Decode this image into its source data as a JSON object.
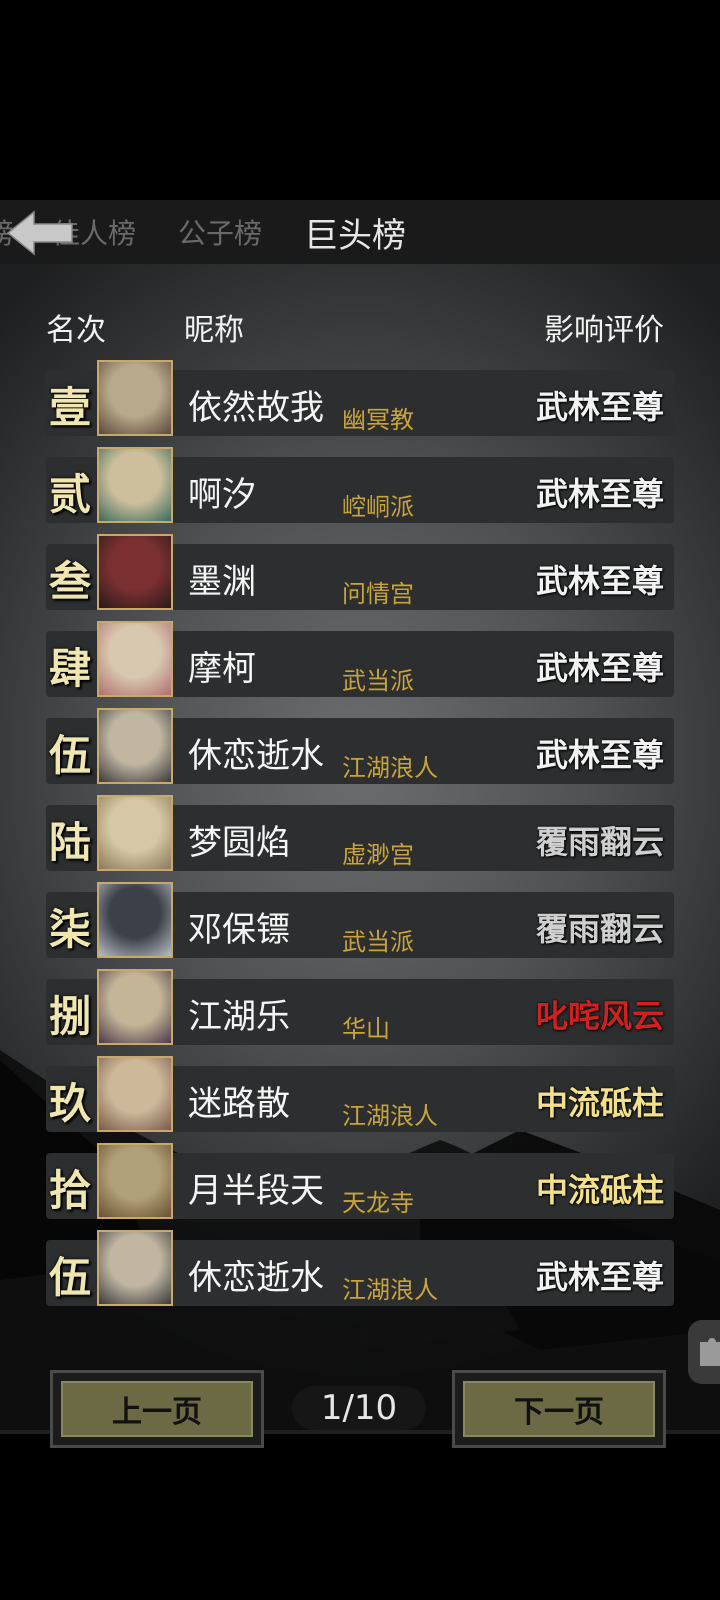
{
  "tabs": [
    {
      "label": "榜"
    },
    {
      "label": "佳人榜"
    },
    {
      "label": "公子榜"
    },
    {
      "label": "巨头榜"
    }
  ],
  "headers": {
    "rank": "名次",
    "nickname": "昵称",
    "rating": "影响评价"
  },
  "rows": [
    {
      "rank": "壹",
      "name": "依然故我",
      "sect": "幽冥教",
      "title": "武林至尊",
      "title_color": "#f2f2f2"
    },
    {
      "rank": "贰",
      "name": "啊汐",
      "sect": "崆峒派",
      "title": "武林至尊",
      "title_color": "#f2f2f2"
    },
    {
      "rank": "叁",
      "name": "墨渊",
      "sect": "问情宫",
      "title": "武林至尊",
      "title_color": "#f2f2f2"
    },
    {
      "rank": "肆",
      "name": "摩柯",
      "sect": "武当派",
      "title": "武林至尊",
      "title_color": "#f2f2f2"
    },
    {
      "rank": "伍",
      "name": "休恋逝水",
      "sect": "江湖浪人",
      "title": "武林至尊",
      "title_color": "#f2f2f2"
    },
    {
      "rank": "陆",
      "name": "梦圆焰",
      "sect": "虚渺宫",
      "title": "覆雨翻云",
      "title_color": "#cfcfcf"
    },
    {
      "rank": "柒",
      "name": "邓保镖",
      "sect": "武当派",
      "title": "覆雨翻云",
      "title_color": "#cfcfcf"
    },
    {
      "rank": "捌",
      "name": "江湖乐",
      "sect": "华山",
      "title": "叱咤风云",
      "title_color": "#d22020"
    },
    {
      "rank": "玖",
      "name": "迷路散",
      "sect": "江湖浪人",
      "title": "中流砥柱",
      "title_color": "#f3e08a"
    },
    {
      "rank": "拾",
      "name": "月半段天",
      "sect": "天龙寺",
      "title": "中流砥柱",
      "title_color": "#f3e08a"
    },
    {
      "rank": "伍",
      "name": "休恋逝水",
      "sect": "江湖浪人",
      "title": "武林至尊",
      "title_color": "#f2f2f2"
    }
  ],
  "pagination": {
    "prev_label": "上一页",
    "next_label": "下一页",
    "page": "1/10"
  }
}
